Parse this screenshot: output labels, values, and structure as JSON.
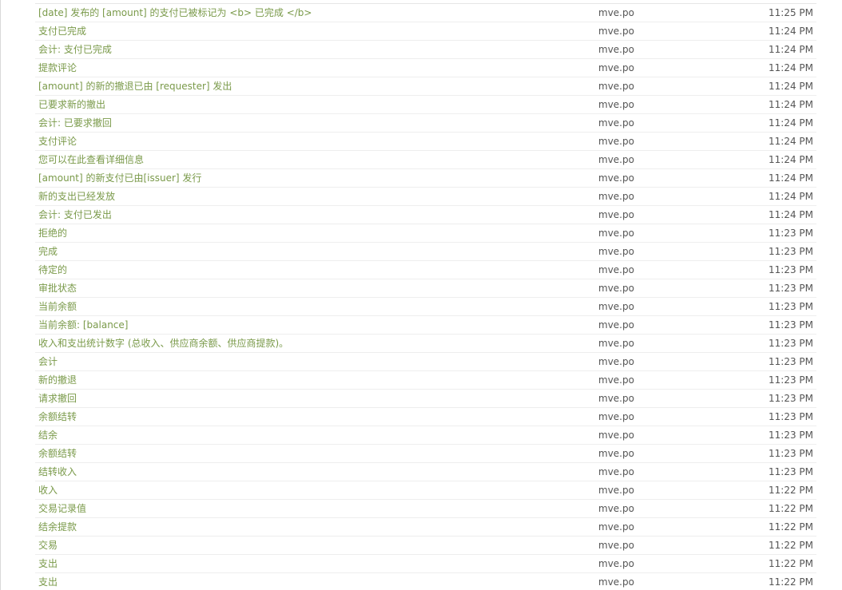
{
  "rows": [
    {
      "text": "[date] 发布的 [amount] 的支付已被标记为 <b> 已完成 </b>",
      "file": "mve.po",
      "time": "11:25 PM"
    },
    {
      "text": "支付已完成",
      "file": "mve.po",
      "time": "11:24 PM"
    },
    {
      "text": "会计: 支付已完成",
      "file": "mve.po",
      "time": "11:24 PM"
    },
    {
      "text": "提款评论",
      "file": "mve.po",
      "time": "11:24 PM"
    },
    {
      "text": "[amount] 的新的撤退已由 [requester] 发出",
      "file": "mve.po",
      "time": "11:24 PM"
    },
    {
      "text": "已要求新的撤出",
      "file": "mve.po",
      "time": "11:24 PM"
    },
    {
      "text": "会计: 已要求撤回",
      "file": "mve.po",
      "time": "11:24 PM"
    },
    {
      "text": "支付评论",
      "file": "mve.po",
      "time": "11:24 PM"
    },
    {
      "text": "您可以在此查看详细信息",
      "file": "mve.po",
      "time": "11:24 PM"
    },
    {
      "text": "[amount] 的新支付已由[issuer] 发行",
      "file": "mve.po",
      "time": "11:24 PM"
    },
    {
      "text": "新的支出已经发放",
      "file": "mve.po",
      "time": "11:24 PM"
    },
    {
      "text": "会计: 支付已发出",
      "file": "mve.po",
      "time": "11:24 PM"
    },
    {
      "text": "拒绝的",
      "file": "mve.po",
      "time": "11:23 PM"
    },
    {
      "text": "完成",
      "file": "mve.po",
      "time": "11:23 PM"
    },
    {
      "text": "待定的",
      "file": "mve.po",
      "time": "11:23 PM"
    },
    {
      "text": "审批状态",
      "file": "mve.po",
      "time": "11:23 PM"
    },
    {
      "text": "当前余额",
      "file": "mve.po",
      "time": "11:23 PM"
    },
    {
      "text": "当前余额: [balance]",
      "file": "mve.po",
      "time": "11:23 PM"
    },
    {
      "text": "收入和支出统计数字 (总收入、供应商余额、供应商提款)。",
      "file": "mve.po",
      "time": "11:23 PM"
    },
    {
      "text": "会计",
      "file": "mve.po",
      "time": "11:23 PM"
    },
    {
      "text": "新的撤退",
      "file": "mve.po",
      "time": "11:23 PM"
    },
    {
      "text": "请求撤回",
      "file": "mve.po",
      "time": "11:23 PM"
    },
    {
      "text": "余额结转",
      "file": "mve.po",
      "time": "11:23 PM"
    },
    {
      "text": "结余",
      "file": "mve.po",
      "time": "11:23 PM"
    },
    {
      "text": "余额结转",
      "file": "mve.po",
      "time": "11:23 PM"
    },
    {
      "text": "结转收入",
      "file": "mve.po",
      "time": "11:23 PM"
    },
    {
      "text": "收入",
      "file": "mve.po",
      "time": "11:22 PM"
    },
    {
      "text": "交易记录值",
      "file": "mve.po",
      "time": "11:22 PM"
    },
    {
      "text": "结余提款",
      "file": "mve.po",
      "time": "11:22 PM"
    },
    {
      "text": "交易",
      "file": "mve.po",
      "time": "11:22 PM"
    },
    {
      "text": "支出",
      "file": "mve.po",
      "time": "11:22 PM"
    },
    {
      "text": "支出",
      "file": "mve.po",
      "time": "11:22 PM"
    }
  ]
}
